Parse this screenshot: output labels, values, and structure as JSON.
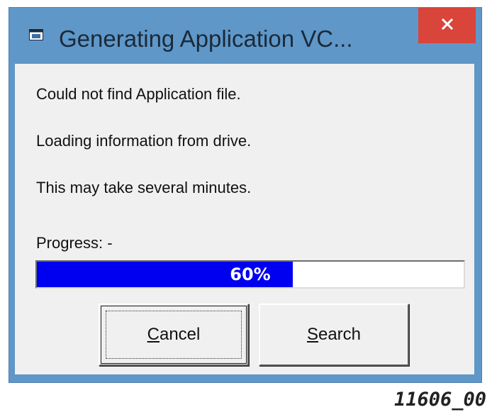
{
  "window": {
    "title": "Generating Application VC...",
    "icon": "app-window-icon",
    "close_icon": "close-icon"
  },
  "messages": [
    "Could not find Application file.",
    "Loading information from drive.",
    "This may take several minutes."
  ],
  "progress": {
    "label": "Progress: -",
    "value_percent": 60,
    "display_text": "60%",
    "fill_color": "#0000f0"
  },
  "buttons": {
    "cancel": {
      "label_first": "C",
      "label_rest": "ancel"
    },
    "search": {
      "label_first": "S",
      "label_rest": "earch"
    }
  },
  "figure_id": "11606_00",
  "colors": {
    "title_bar": "#5f97c8",
    "close_button": "#d9443b",
    "client_bg": "#f0f0f0"
  }
}
